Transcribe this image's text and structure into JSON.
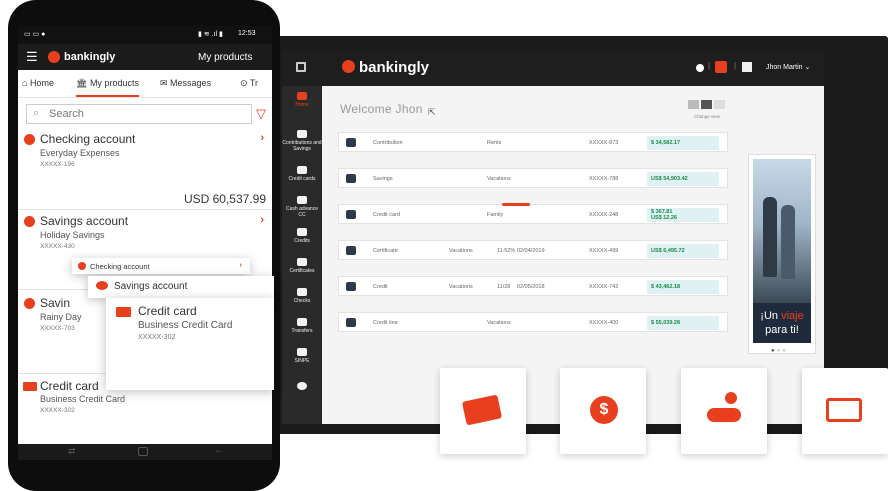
{
  "desktop": {
    "brand": "bankingly",
    "user_name": "Jhon Martin",
    "welcome": "Welcome Jhon",
    "change_view": "Change view",
    "sidebar": [
      {
        "label": "Home",
        "icon": "home-icon"
      },
      {
        "label": "Contributions and Savings",
        "icon": "bank-icon"
      },
      {
        "label": "Credit cards",
        "icon": "card-icon"
      },
      {
        "label": "Cash advance CC",
        "icon": "cash-icon"
      },
      {
        "label": "Credits",
        "icon": "credits-icon"
      },
      {
        "label": "Certificates",
        "icon": "certificate-icon"
      },
      {
        "label": "Checks",
        "icon": "check-icon"
      },
      {
        "label": "Transfers",
        "icon": "transfer-icon"
      },
      {
        "label": "SINPE",
        "icon": "sinpe-icon"
      }
    ],
    "accounts": [
      {
        "type": "Contribution",
        "desc": "Rents",
        "rate": "",
        "date": "",
        "number": "XXXXX-873",
        "amount": "$ 34,582.17"
      },
      {
        "type": "Savings",
        "desc": "Vacations",
        "rate": "",
        "date": "",
        "number": "XXXXX-788",
        "amount": "US$ 54,903.42"
      },
      {
        "type": "Credit card",
        "desc": "Family",
        "rate": "",
        "date": "",
        "number": "XXXXX-248",
        "amount": "$ 367.81",
        "amount2": "US$ 12.26"
      },
      {
        "type": "Certificate",
        "desc": "Vacations",
        "rate": "11.52%",
        "date": "02/04/2019",
        "number": "XXXXX-499",
        "amount": "US$ 6,495.72"
      },
      {
        "type": "Credit",
        "desc": "Vacations",
        "rate": "11/28",
        "date": "02/05/2018",
        "number": "XXXXX-742",
        "amount": "$ 43,462.18"
      },
      {
        "type": "Credit line",
        "desc": "Vacations",
        "rate": "",
        "date": "",
        "number": "XXXXX-400",
        "amount": "$ 55,039.28"
      }
    ],
    "banner": {
      "line1": "¡Un",
      "line1_accent": "viaje",
      "line2": "para ti!"
    }
  },
  "mobile": {
    "status_time": "12:53",
    "brand": "bankingly",
    "title": "My products",
    "tabs": [
      "Home",
      "My products",
      "Messages",
      "Tr"
    ],
    "search_placeholder": "Search",
    "accounts": [
      {
        "title": "Checking account",
        "sub": "Everyday Expenses",
        "num": "XXXXX-196",
        "amount": "USD 60,537.99"
      },
      {
        "title": "Savings account",
        "sub": "Holiday Savings",
        "num": "XXXXX-430"
      },
      {
        "title": "Savin",
        "sub": "Rainy Day",
        "num": "XXXXX-703"
      },
      {
        "title": "Credit card",
        "sub": "Business Credit Card",
        "num": "XXXXX-302"
      }
    ],
    "popup": {
      "checking": "Checking account",
      "savings": "Savings account",
      "card_title": "Credit card",
      "card_sub": "Business Credit Card",
      "card_num": "XXXXX-302"
    }
  },
  "colors": {
    "accent": "#e8401e",
    "dark": "#1e1e1e",
    "amount_bg": "#dff1f3"
  }
}
